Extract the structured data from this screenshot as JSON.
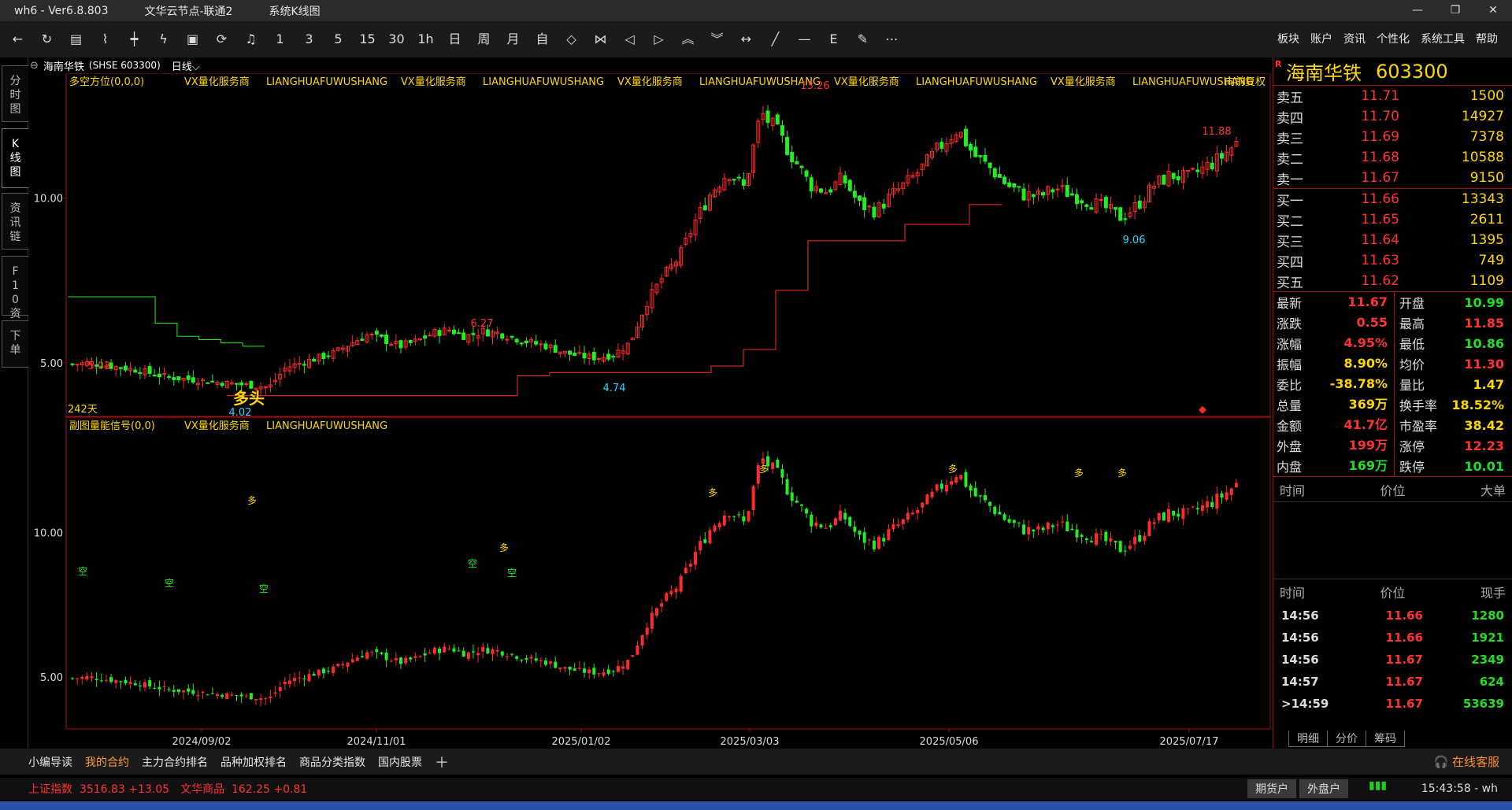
{
  "title": {
    "app": "wh6",
    "version": "Ver6.8.803",
    "server": "文华云节点-联通2",
    "view": "系统K线图"
  },
  "toolbar_menus": [
    "板块",
    "账户",
    "资讯",
    "个性化",
    "系统工具",
    "帮助"
  ],
  "toolbar_icons": [
    "back-icon",
    "refresh-icon",
    "table-icon",
    "line-icon",
    "kline-icon",
    "flash-icon",
    "portrait-icon",
    "cycle-icon",
    "bell-icon",
    "1",
    "3",
    "5",
    "15",
    "30",
    "1h",
    "日",
    "周",
    "月",
    "自",
    "zoom-in-icon",
    "zoom-out-icon",
    "left-icon",
    "right-icon",
    "up-icon",
    "down-icon",
    "fit-icon",
    "draw-line-icon",
    "hline-icon",
    "fib-icon",
    "pen-icon",
    "more-icon"
  ],
  "left_tabs": [
    "分时图",
    "K线图",
    "资讯链",
    "F10资料",
    "下单"
  ],
  "instrument": {
    "name": "海南华铁",
    "market": "(SHSE 603300)",
    "period": "日线"
  },
  "main_chart": {
    "indicator": "多空方位(0,0,0)",
    "ads": [
      "VX量化服务商",
      "LIANGHUAFUWUSHANG",
      "VX量化服务商",
      "LIANGHUAFUWUSHANG",
      "VX量化服务商",
      "LIANGHUAFUWUSHANG",
      "VX量化服务商",
      "LIANGHUAFUWUSHANG",
      "VX量化服务商",
      "LIANGHUAFUWUSHANG"
    ],
    "adjust": "向前复权",
    "bars_label": "242天",
    "signal_label": "多头",
    "price_labels": [
      "13.26",
      "11.88",
      "9.06",
      "6.27",
      "5.03",
      "4.74",
      "4.02"
    ],
    "y_ticks": [
      "10.00",
      "5.00"
    ]
  },
  "sub_chart": {
    "indicator": "副图量能信号(0,0)",
    "ads": [
      "VX量化服务商",
      "LIANGHUAFUWUSHANG"
    ],
    "y_ticks": [
      "10.00",
      "5.00"
    ],
    "tag_buy": "多",
    "tag_sell": "空"
  },
  "x_axis": [
    "2024/09/02",
    "2024/11/01",
    "2025/01/02",
    "2025/03/03",
    "2025/05/06",
    "2025/07/17"
  ],
  "chart_data": {
    "type": "candlestick",
    "y_range": [
      3.8,
      13.5
    ],
    "extremes": {
      "high": 13.26,
      "low": 4.02,
      "last_high": 11.88
    },
    "close_path": [
      4.95,
      5.0,
      4.92,
      4.85,
      4.78,
      4.65,
      4.55,
      4.5,
      4.45,
      4.4,
      4.35,
      4.3,
      4.25,
      4.85,
      5.0,
      5.15,
      5.3,
      5.6,
      5.85,
      5.7,
      5.5,
      5.65,
      5.9,
      6.0,
      5.8,
      5.95,
      5.9,
      5.75,
      5.6,
      5.5,
      5.3,
      5.2,
      5.15,
      5.25,
      5.6,
      6.8,
      7.6,
      8.2,
      9.3,
      10.2,
      10.8,
      10.3,
      12.6,
      12.0,
      11.2,
      10.4,
      10.2,
      10.6,
      9.8,
      9.6,
      10.1,
      10.5,
      11.0,
      11.6,
      12.1,
      11.3,
      10.9,
      10.4,
      10.1,
      10.05,
      10.3,
      10.1,
      9.9,
      9.7,
      9.4,
      9.8,
      10.4,
      10.7,
      10.6,
      10.9,
      11.2,
      11.67
    ],
    "support_line": [
      4.0,
      4.0,
      4.0,
      4.0,
      4.0,
      4.0,
      4.0,
      4.0,
      4.0,
      4.6,
      4.7,
      4.7,
      4.7,
      4.7,
      4.7,
      4.9,
      5.4,
      7.2,
      8.7,
      8.7,
      8.7,
      9.2,
      9.2,
      9.8
    ],
    "resistance_line": [
      7.0,
      7.0,
      7.0,
      7.0,
      6.2,
      5.8,
      5.7,
      5.6,
      5.5
    ]
  },
  "quote": {
    "name": "海南华铁",
    "code": "603300",
    "asks": [
      {
        "l": "卖五",
        "p": "11.71",
        "v": "1500"
      },
      {
        "l": "卖四",
        "p": "11.70",
        "v": "14927"
      },
      {
        "l": "卖三",
        "p": "11.69",
        "v": "7378"
      },
      {
        "l": "卖二",
        "p": "11.68",
        "v": "10588"
      },
      {
        "l": "卖一",
        "p": "11.67",
        "v": "9150"
      }
    ],
    "bids": [
      {
        "l": "买一",
        "p": "11.66",
        "v": "13343"
      },
      {
        "l": "买二",
        "p": "11.65",
        "v": "2611"
      },
      {
        "l": "买三",
        "p": "11.64",
        "v": "1395"
      },
      {
        "l": "买四",
        "p": "11.63",
        "v": "749"
      },
      {
        "l": "买五",
        "p": "11.62",
        "v": "1109"
      }
    ],
    "stats": [
      {
        "l": "最新",
        "v": "11.67",
        "c": "red",
        "l2": "开盘",
        "v2": "10.99",
        "c2": "grn"
      },
      {
        "l": "涨跌",
        "v": "0.55",
        "c": "red",
        "l2": "最高",
        "v2": "11.85",
        "c2": "red"
      },
      {
        "l": "涨幅",
        "v": "4.95%",
        "c": "red",
        "l2": "最低",
        "v2": "10.86",
        "c2": "grn"
      },
      {
        "l": "振幅",
        "v": "8.90%",
        "c": "yel",
        "l2": "均价",
        "v2": "11.30",
        "c2": "red"
      },
      {
        "l": "委比",
        "v": "-38.78%",
        "c": "yel",
        "l2": "量比",
        "v2": "1.47",
        "c2": "yel"
      },
      {
        "l": "总量",
        "v": "369万",
        "c": "yel",
        "l2": "换手率",
        "v2": "18.52%",
        "c2": "yel"
      },
      {
        "l": "金额",
        "v": "41.7亿",
        "c": "red",
        "l2": "市盈率",
        "v2": "38.42",
        "c2": "yel"
      },
      {
        "l": "外盘",
        "v": "199万",
        "c": "red",
        "l2": "涨停",
        "v2": "12.23",
        "c2": "red"
      },
      {
        "l": "内盘",
        "v": "169万",
        "c": "grn",
        "l2": "跌停",
        "v2": "10.01",
        "c2": "grn"
      }
    ],
    "big_head": [
      "时间",
      "价位",
      "大单"
    ],
    "tick_head": [
      "时间",
      "价位",
      "现手"
    ],
    "ticks": [
      {
        "t": "14:56",
        "p": "11.66",
        "v": "1280"
      },
      {
        "t": "14:56",
        "p": "11.66",
        "v": "1921"
      },
      {
        "t": "14:56",
        "p": "11.67",
        "v": "2349"
      },
      {
        "t": "14:57",
        "p": "11.67",
        "v": "624"
      },
      {
        "t": ">14:59",
        "p": "11.67",
        "v": "53639"
      }
    ],
    "bottom_tabs": [
      "明细",
      "分价",
      "筹码"
    ]
  },
  "bottom_tabs": [
    "小编导读",
    "我的合约",
    "主力合约排名",
    "品种加权排名",
    "商品分类指数",
    "国内股票"
  ],
  "service": "在线客服",
  "status": {
    "idx1_name": "上证指数",
    "idx1_val": "3516.83",
    "idx1_chg": "+13.05",
    "idx2_name": "文华商品",
    "idx2_val": "162.25",
    "idx2_chg": "+0.81",
    "btn1": "期货户",
    "btn2": "外盘户",
    "clock": "15:43:58 - wh"
  }
}
